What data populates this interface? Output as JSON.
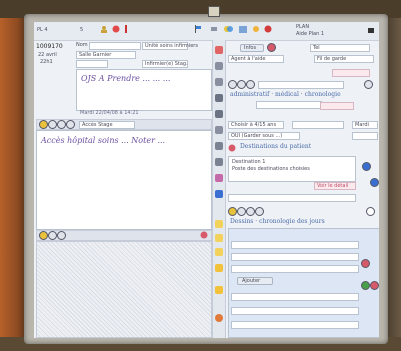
{
  "header": {
    "left_id": "PL 4",
    "left_count": "5",
    "right_title": "PLAN",
    "right_sub": "Aide Plan 1"
  },
  "patient": {
    "id_label": "1009170",
    "date_line": "22 avril",
    "time_line": "22h1",
    "nom_label": "Nom",
    "nom_value": "",
    "service_value": "Unité soins infirmiers",
    "lieu_value": "Salle Garnier",
    "stage_value": "Infirmier(e) Stag."
  },
  "note_top": {
    "text": "OJS A Prendre ... ... ...",
    "timestamp": "Mardi 22/04/08 à 14:21"
  },
  "note_mid_header": {
    "dropdown": "Accès Stage"
  },
  "note_mid": {
    "text": "Accès hôpital soins ... Noter ..."
  },
  "right": {
    "tab_a": "Infos",
    "tab_b": "Tél",
    "dropdown_a": "Agent à l'aide",
    "dropdown_b": "Fil de garde",
    "section1_title": "administratif · médical · chronologie",
    "chip": "Choisir à 4/15 ans",
    "select_a": "",
    "date_chip": "Mardi",
    "pill": "OUI (Garder sous ...)",
    "section2_title": "Destinations du patient",
    "dest_line1": "Destination 1",
    "dest_line2": "Poste des destinations choisies",
    "dest_link": "Voir le détail",
    "section3_title": "Dessins · chronologie des jours",
    "small_btn": "Ajouter"
  }
}
